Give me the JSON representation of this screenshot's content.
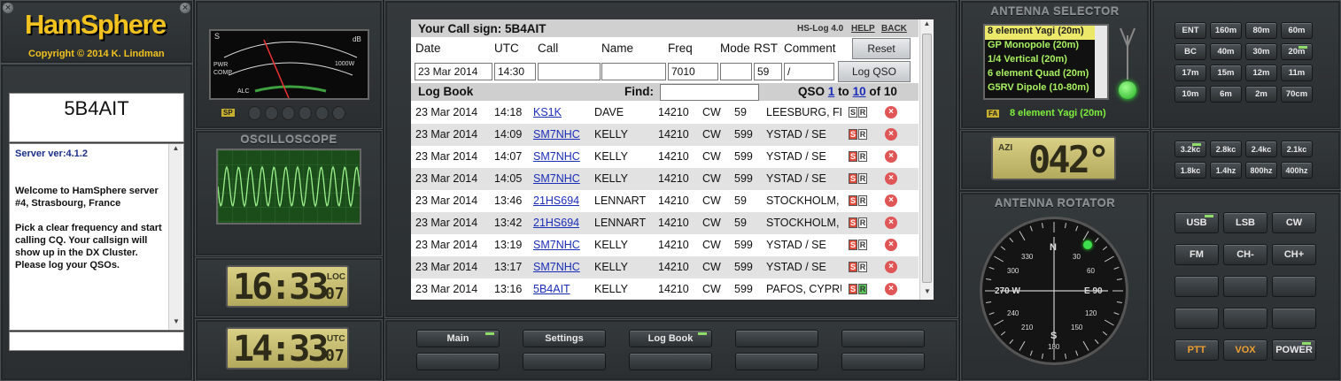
{
  "branding": {
    "logo": "HamSphere",
    "copyright": "Copyright © 2014 K. Lindman"
  },
  "station": {
    "callsign": "5B4AIT",
    "server_ver": "Server ver:4.1.2",
    "message1": "Welcome to HamSphere server #4, Strasbourg, France",
    "message2": "Pick a clear frequency and start calling CQ. Your callsign will show up in the DX Cluster. Please log your QSOs."
  },
  "meter": {
    "scale_top": [
      "S",
      "1",
      "3",
      "5",
      "7",
      "9",
      "+20",
      "+40",
      "+60",
      "dB"
    ],
    "scale_mid": [
      "10",
      "50",
      "100",
      "250",
      "500",
      "1000W"
    ],
    "labels": [
      "PWR",
      "COMP",
      "ALC"
    ],
    "sp": "SP"
  },
  "oscilloscope": {
    "title": "OSCILLOSCOPE"
  },
  "clocks": {
    "local": {
      "time": "16:33",
      "sec": "07",
      "label": "LOC"
    },
    "utc": {
      "time": "14:33",
      "sec": "07",
      "label": "UTC"
    }
  },
  "nav": {
    "main": "Main",
    "settings": "Settings",
    "logbook": "Log Book"
  },
  "logform": {
    "title": "Your Call sign: 5B4AIT",
    "app": "HS-Log 4.0",
    "help": "HELP",
    "back": "BACK",
    "cols": {
      "date": "Date",
      "utc": "UTC",
      "call": "Call",
      "name": "Name",
      "freq": "Freq",
      "mode": "Mode",
      "rst": "RST",
      "comment": "Comment"
    },
    "reset": "Reset",
    "log_qso": "Log QSO",
    "values": {
      "date": "23 Mar 2014",
      "utc": "14:30",
      "call": "",
      "name": "",
      "freq": "7010",
      "mode": "",
      "rst": "59",
      "comment": "/"
    }
  },
  "logbook": {
    "title": "Log Book",
    "find": "Find:",
    "qso_label": "QSO",
    "qso_from": "1",
    "qso_to_label": "to",
    "qso_to": "10",
    "qso_of": "of 10",
    "rows": [
      {
        "date": "23 Mar 2014",
        "utc": "14:18",
        "call": "KS1K",
        "name": "DAVE",
        "freq": "14210",
        "mode": "CW",
        "rst": "59",
        "loc": "LEESBURG, FL",
        "s": "S",
        "r": "R"
      },
      {
        "date": "23 Mar 2014",
        "utc": "14:09",
        "call": "SM7NHC",
        "name": "KELLY",
        "freq": "14210",
        "mode": "CW",
        "rst": "599",
        "loc": "YSTAD / SE",
        "s": "S",
        "r": "R"
      },
      {
        "date": "23 Mar 2014",
        "utc": "14:07",
        "call": "SM7NHC",
        "name": "KELLY",
        "freq": "14210",
        "mode": "CW",
        "rst": "599",
        "loc": "YSTAD / SE",
        "s": "S",
        "r": "R"
      },
      {
        "date": "23 Mar 2014",
        "utc": "14:05",
        "call": "SM7NHC",
        "name": "KELLY",
        "freq": "14210",
        "mode": "CW",
        "rst": "599",
        "loc": "YSTAD / SE",
        "s": "S",
        "r": "R"
      },
      {
        "date": "23 Mar 2014",
        "utc": "13:46",
        "call": "21HS694",
        "name": "LENNART",
        "freq": "14210",
        "mode": "CW",
        "rst": "59",
        "loc": "STOCKHOLM, V",
        "s": "S",
        "r": "R"
      },
      {
        "date": "23 Mar 2014",
        "utc": "13:42",
        "call": "21HS694",
        "name": "LENNART",
        "freq": "14210",
        "mode": "CW",
        "rst": "59",
        "loc": "STOCKHOLM, V",
        "s": "S",
        "r": "R"
      },
      {
        "date": "23 Mar 2014",
        "utc": "13:19",
        "call": "SM7NHC",
        "name": "KELLY",
        "freq": "14210",
        "mode": "CW",
        "rst": "599",
        "loc": "YSTAD / SE",
        "s": "S",
        "r": "R"
      },
      {
        "date": "23 Mar 2014",
        "utc": "13:17",
        "call": "SM7NHC",
        "name": "KELLY",
        "freq": "14210",
        "mode": "CW",
        "rst": "599",
        "loc": "YSTAD / SE",
        "s": "S",
        "r": "R"
      },
      {
        "date": "23 Mar 2014",
        "utc": "13:16",
        "call": "5B4AIT",
        "name": "KELLY",
        "freq": "14210",
        "mode": "CW",
        "rst": "599",
        "loc": "PAFOS, CYPRU",
        "s": "S",
        "r": "R"
      }
    ]
  },
  "antenna": {
    "title": "ANTENNA SELECTOR",
    "items": [
      "8 element Yagi (20m)",
      "GP Monopole (20m)",
      "1/4 Vertical (20m)",
      "6 element Quad (20m)",
      "G5RV Dipole (10-80m)"
    ],
    "fa": "FA",
    "selected": "8 element Yagi (20m)"
  },
  "azimuth": {
    "label": "AZI",
    "value": "042°"
  },
  "rotator": {
    "title": "ANTENNA ROTATOR",
    "n": "N",
    "s": "S",
    "e": "E 90",
    "w": "270 W",
    "ticks": [
      "30",
      "60",
      "120",
      "150",
      "180",
      "210",
      "240",
      "300",
      "330"
    ]
  },
  "bands": [
    "ENT",
    "160m",
    "80m",
    "60m",
    "BC",
    "40m",
    "30m",
    "20m",
    "17m",
    "15m",
    "12m",
    "11m",
    "10m",
    "6m",
    "2m",
    "70cm"
  ],
  "filters": [
    "3.2kc",
    "2.8kc",
    "2.4kc",
    "2.1kc",
    "1.8kc",
    "1.4hz",
    "800hz",
    "400hz"
  ],
  "modes": [
    "USB",
    "LSB",
    "CW",
    "FM",
    "CH-",
    "CH+"
  ],
  "controls": {
    "ptt": "PTT",
    "vox": "VOX",
    "power": "POWER"
  },
  "colors": {
    "led_green": "#8fdc6a",
    "link": "#1a2db8",
    "lcd": "#d9cf85",
    "antenna_text": "#a8f060"
  }
}
